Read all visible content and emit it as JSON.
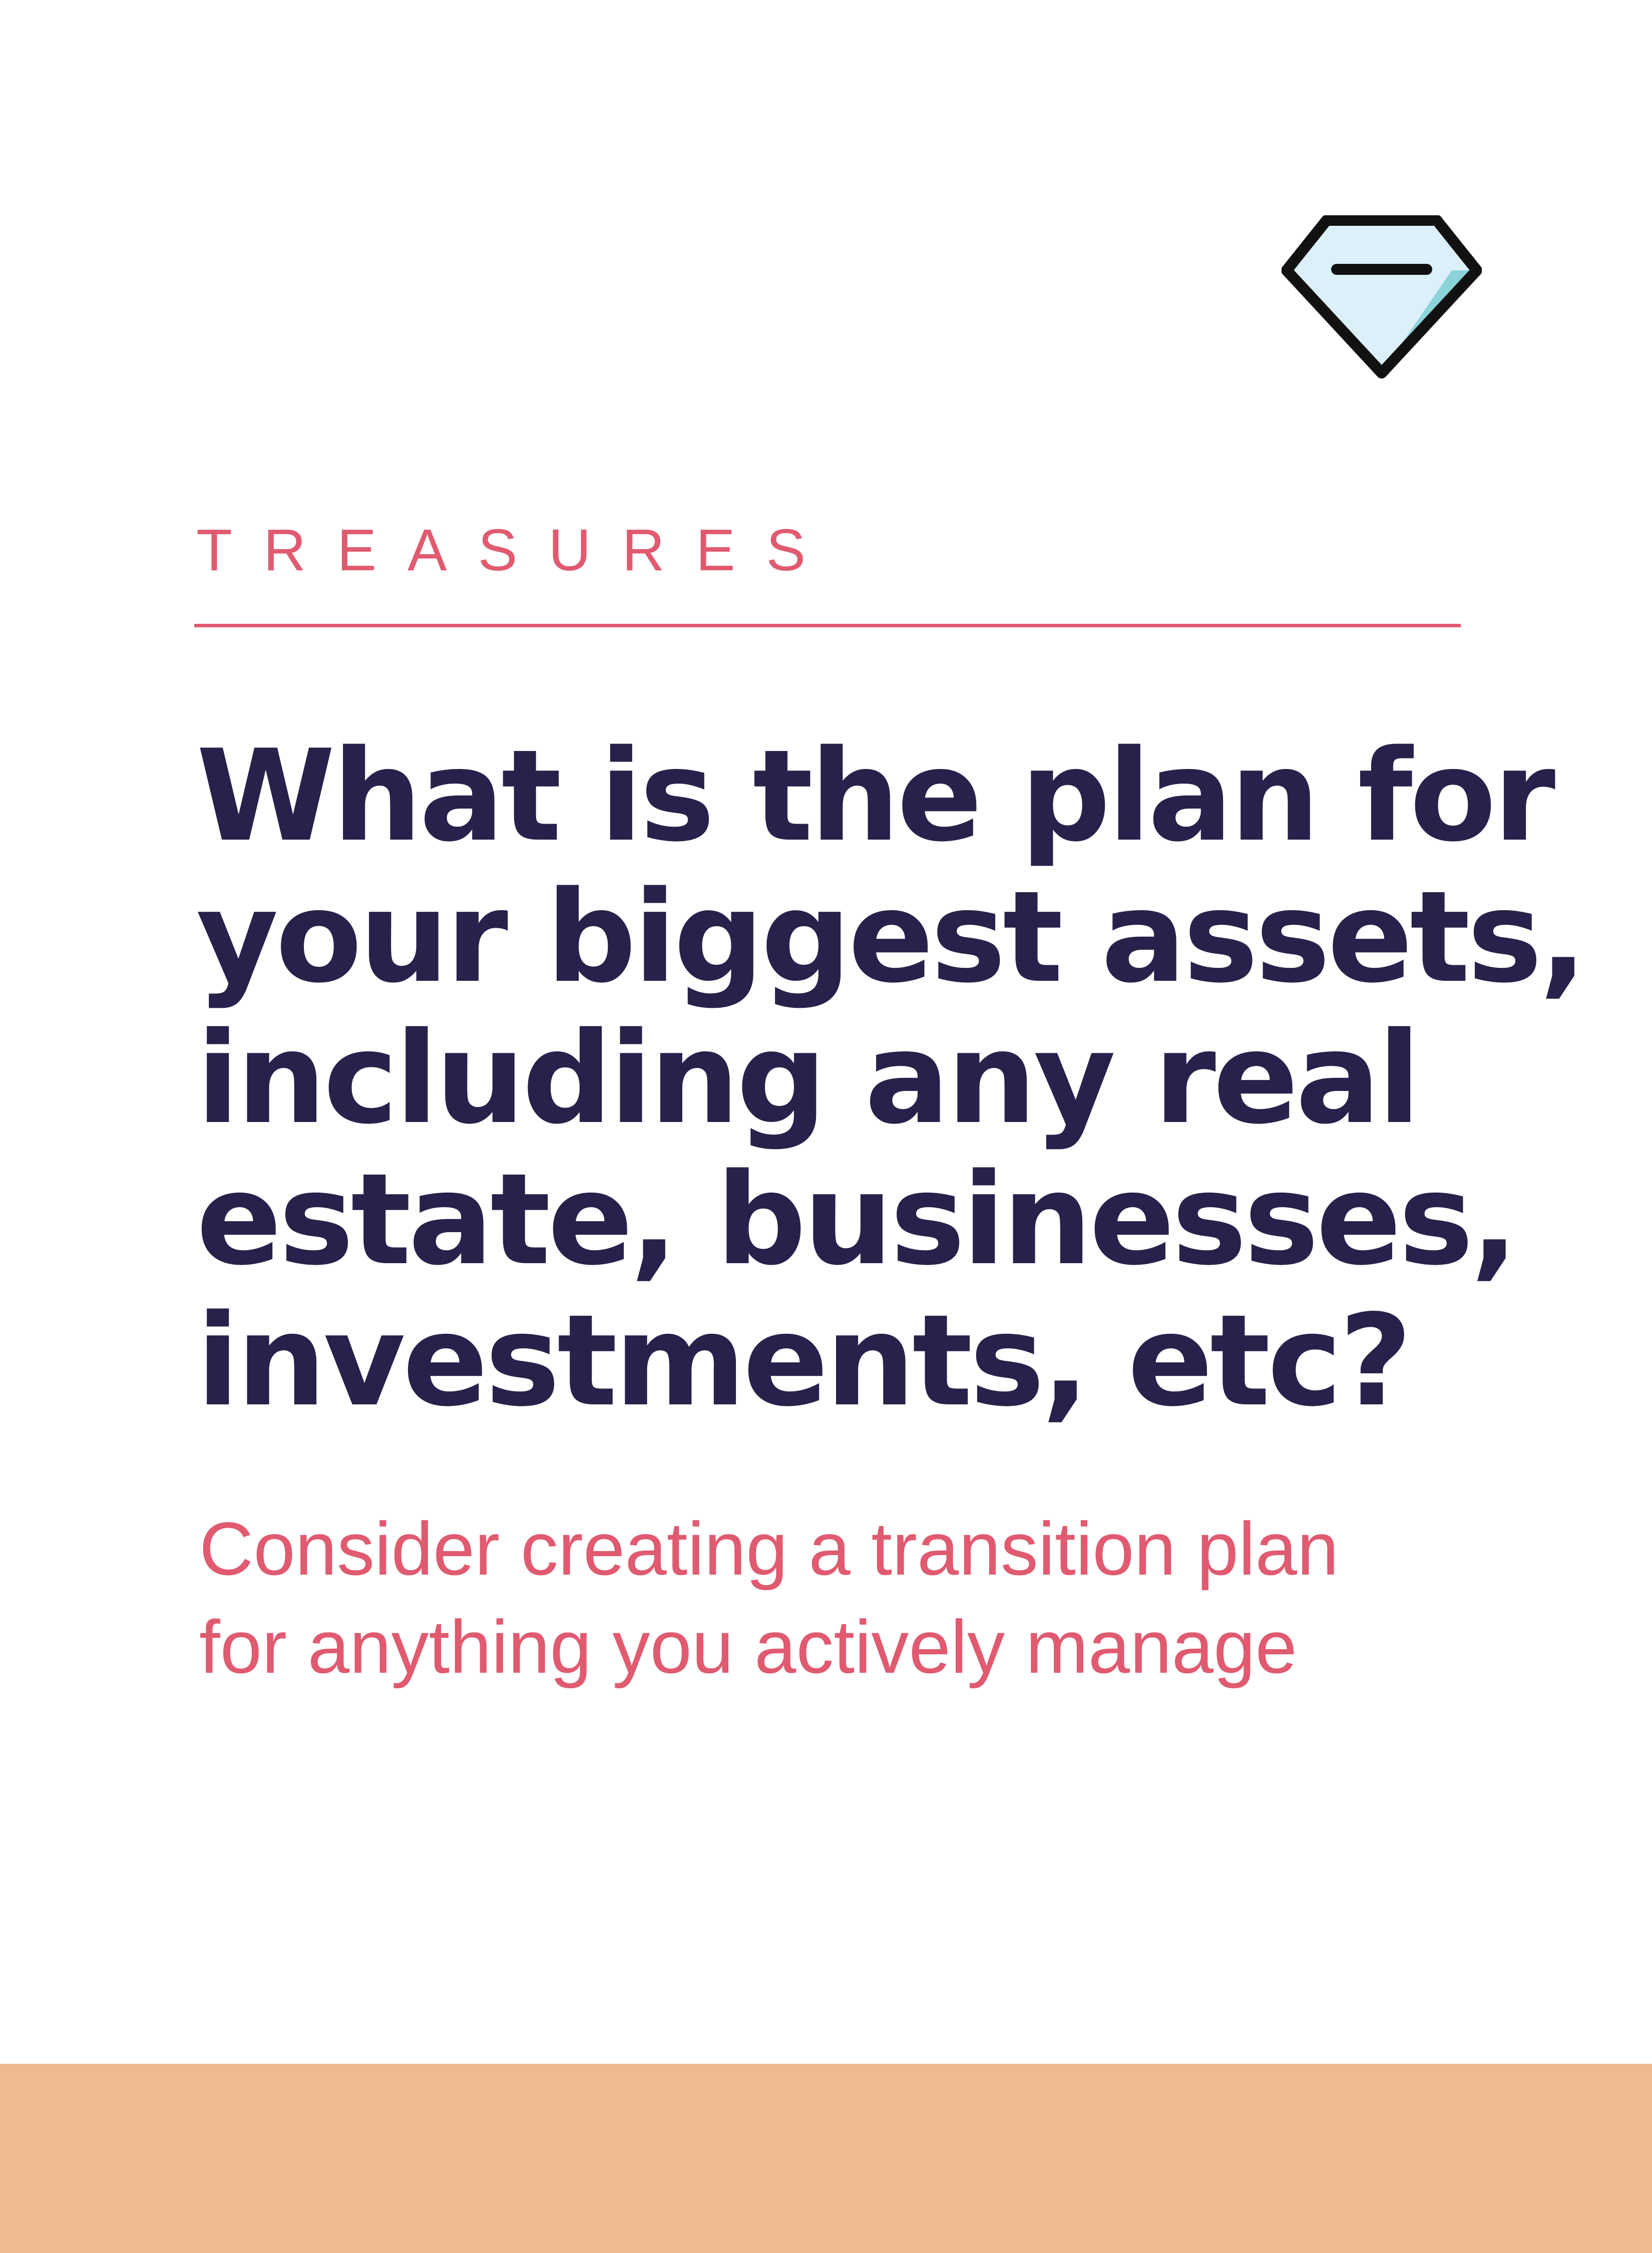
{
  "icon": {
    "name": "diamond-icon",
    "fill_light": "#dcf0f9",
    "fill_accent": "#8ad3d8",
    "stroke": "#111111"
  },
  "eyebrow": {
    "text": "TREASURES"
  },
  "headline": {
    "lines": [
      "What is the plan for",
      "your biggest assets,",
      "including any real",
      "estate, businesses,",
      "investments, etc?"
    ]
  },
  "subhead": {
    "lines": [
      "Consider creating a transition plan",
      "for anything you actively manage"
    ]
  },
  "colors": {
    "accent": "#e05a70",
    "headline": "#27214b",
    "footer_band": "#eebb90",
    "background": "#ffffff"
  }
}
